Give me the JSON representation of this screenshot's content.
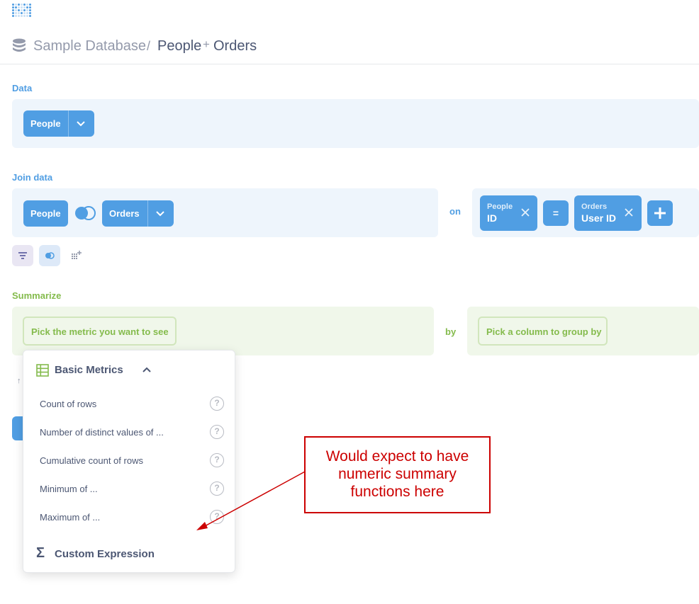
{
  "logo": {
    "icon": "metabase-logo-icon"
  },
  "breadcrumb": {
    "database": "Sample Database",
    "separator": "/",
    "table_1": "People",
    "plus": "+",
    "table_2": "Orders"
  },
  "data_step": {
    "label": "Data",
    "table": "People"
  },
  "join_step": {
    "label": "Join data",
    "left_table": "People",
    "right_table": "Orders",
    "on_label": "on",
    "left_condition": {
      "table": "People",
      "column": "ID"
    },
    "operator": "=",
    "right_condition": {
      "table": "Orders",
      "column": "User ID"
    }
  },
  "summarize_step": {
    "label": "Summarize",
    "metric_placeholder": "Pick the metric you want to see",
    "by_label": "by",
    "group_placeholder": "Pick a column to group by"
  },
  "metric_popover": {
    "section_title": "Basic Metrics",
    "items": [
      {
        "label": "Count of rows"
      },
      {
        "label": "Number of distinct values of ..."
      },
      {
        "label": "Cumulative count of rows"
      },
      {
        "label": "Minimum of ..."
      },
      {
        "label": "Maximum of ..."
      }
    ],
    "help_glyph": "?",
    "custom_expression": "Custom Expression",
    "sigma": "Σ"
  },
  "annotation": {
    "line_1": "Would expect to have",
    "line_2": "numeric summary",
    "line_3": "functions here"
  },
  "colors": {
    "brand": "#509ee3",
    "summarize": "#84bb4c",
    "annotation": "#cc0000"
  }
}
